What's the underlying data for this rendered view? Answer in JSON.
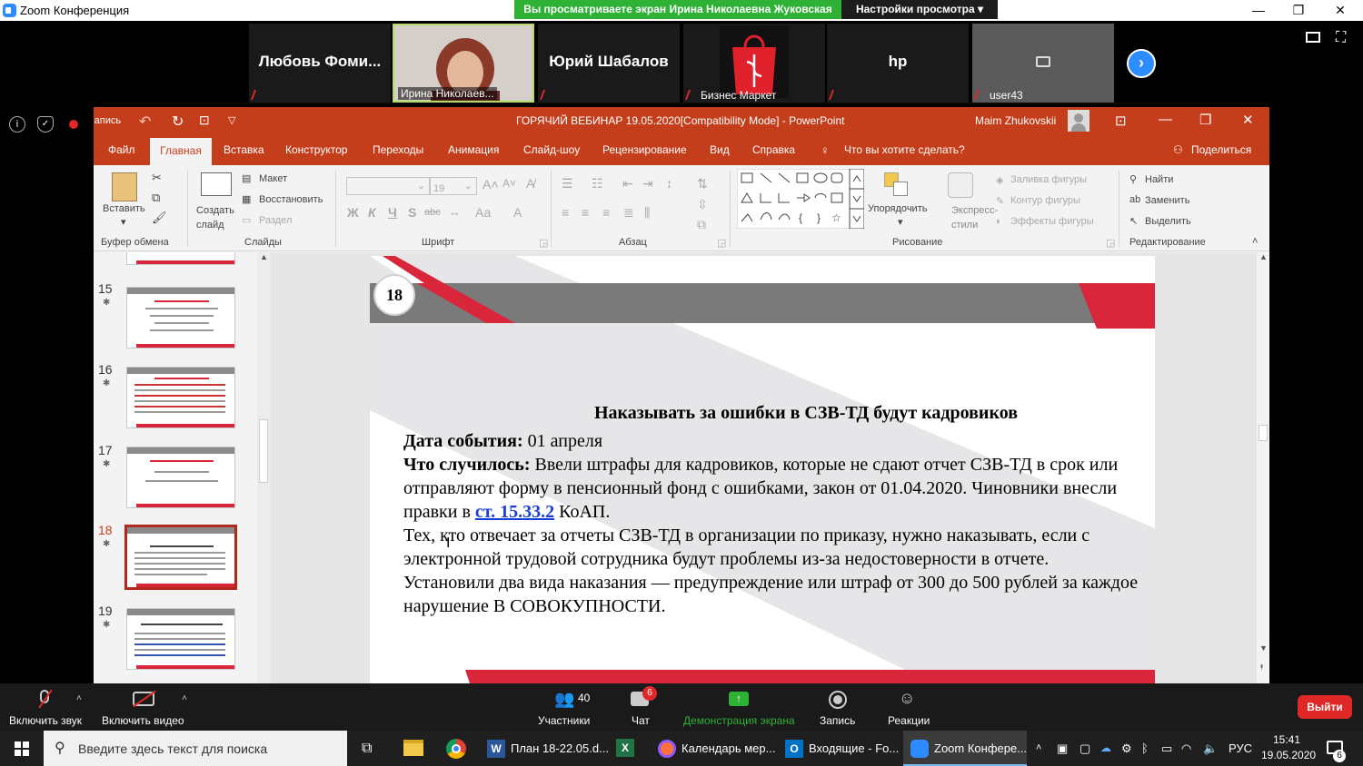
{
  "zoom": {
    "window_title": "Zoom Конференция",
    "share_banner": "Вы просматриваете экран Ирина Николаевна Жуковская",
    "view_options": "Настройки просмотра",
    "participants_gallery": [
      {
        "name": "Любовь Фоми...",
        "has_video": false
      },
      {
        "name": "Ирина Николаев...",
        "has_video": true
      },
      {
        "name": "Юрий Шабалов",
        "has_video": false
      },
      {
        "name": "Бизнес Маркет",
        "has_video": true
      },
      {
        "name": "hp",
        "has_video": false
      },
      {
        "name": "user43",
        "has_video": false
      }
    ],
    "record_label": "Запись",
    "toolbar": {
      "mute": "Включить звук",
      "video": "Включить видео",
      "participants": "Участники",
      "participants_count": "40",
      "chat": "Чат",
      "chat_badge": "6",
      "share": "Демонстрация экрана",
      "record": "Запись",
      "reactions": "Реакции",
      "leave": "Выйти"
    }
  },
  "powerpoint": {
    "title": "ГОРЯЧИЙ ВЕБИНАР 19.05.2020[Compatibility Mode]  -  PowerPoint",
    "user": "Maim Zhukovskii",
    "tabs": [
      "Файл",
      "Главная",
      "Вставка",
      "Конструктор",
      "Переходы",
      "Анимация",
      "Слайд-шоу",
      "Рецензирование",
      "Вид",
      "Справка"
    ],
    "active_tab": "Главная",
    "tell_me": "Что вы хотите сделать?",
    "share": "Поделиться",
    "ribbon": {
      "paste": "Вставить",
      "clipboard_group": "Буфер обмена",
      "new_slide": "Создать слайд",
      "layout": "Макет",
      "reset": "Восстановить",
      "section": "Раздел",
      "slides_group": "Слайды",
      "font_size": "19",
      "font_group": "Шрифт",
      "paragraph_group": "Абзац",
      "arrange": "Упорядочить",
      "quick_styles": "Экспресс-стили",
      "shape_fill": "Заливка фигуры",
      "shape_outline": "Контур фигуры",
      "shape_effects": "Эффекты фигуры",
      "drawing_group": "Рисование",
      "find": "Найти",
      "replace": "Заменить",
      "select": "Выделить",
      "editing_group": "Редактирование",
      "bold": "Ж",
      "italic": "К",
      "underline": "Ч",
      "shadow": "S",
      "strike": "abc",
      "change_case": "Аа",
      "font_color": "А"
    },
    "thumbnails": [
      {
        "num": "15",
        "selected": false
      },
      {
        "num": "16",
        "selected": false
      },
      {
        "num": "17",
        "selected": false
      },
      {
        "num": "18",
        "selected": true
      },
      {
        "num": "19",
        "selected": false
      }
    ],
    "slide": {
      "number": "18",
      "heading": "Наказывать за ошибки в СЗВ-ТД будут кадровиков",
      "date_label": "Дата события:",
      "date_value": " 01 апреля",
      "what_label": "Что случилось:",
      "what_value": " Ввели штрафы для кадровиков, которые не сдают отчет СЗВ-ТД в срок или отправляют форму в пенсионный фонд с ошибками, закон от 01.04.2020. Чиновники внесли правки в ",
      "law_link": "ст. 15.33.2",
      "law_tail": " КоАП.",
      "para2": "Тех, кто отвечает за отчеты СЗВ-ТД в организации по приказу, нужно наказывать, если с электронной трудовой сотрудника будут проблемы из-за недостоверности в отчете. Установили два вида наказания — предупреждение или штраф от 300 до 500 рублей за каждое нарушение В СОВОКУПНОСТИ."
    }
  },
  "taskbar": {
    "search_placeholder": "Введите здесь текст для поиска",
    "apps": [
      {
        "label": "План 18-22.05.d..."
      },
      {
        "label": "Календарь мер..."
      },
      {
        "label": "Входящие - Fo..."
      },
      {
        "label": "Zoom Конфере..."
      }
    ],
    "lang": "РУС",
    "time": "15:41",
    "date": "19.05.2020",
    "notifications": "6"
  },
  "colors": {
    "ppt_red": "#c43e1c",
    "zoom_green": "#2eb135",
    "zoom_blue": "#2d8cff",
    "leave_red": "#e02828",
    "slide_red": "#d9263a",
    "slide_gray": "#7a7a7a"
  }
}
